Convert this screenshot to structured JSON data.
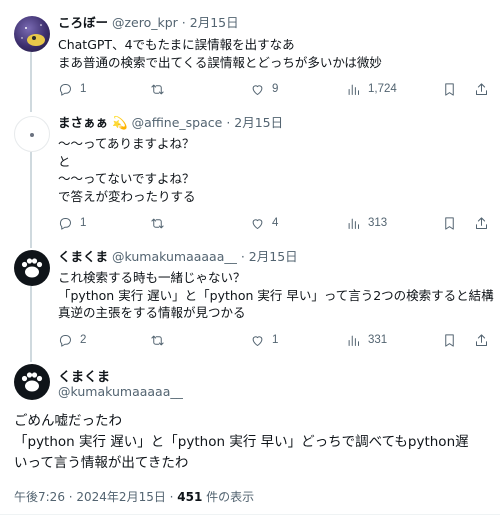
{
  "replies": [
    {
      "name": "ころぼー",
      "handle": "@zero_kpr",
      "date": "2月15日",
      "text": "ChatGPT、4でもたまに誤情報を出すなあ\nまあ普通の検索で出てくる誤情報とどっちが多いかは微妙",
      "reply_count": "1",
      "retweet_count": "",
      "like_count": "9",
      "view_count": "1,724"
    },
    {
      "name": "まさぁぁ",
      "badge": "💫",
      "handle": "@affine_space",
      "date": "2月15日",
      "text": "〜〜ってありますよね？\nと\n〜〜ってないですよね？\nで答えが変わったりする",
      "reply_count": "1",
      "retweet_count": "",
      "like_count": "4",
      "view_count": "313"
    },
    {
      "name": "くまくま",
      "handle": "@kumakumaaaaa__",
      "date": "2月15日",
      "text": "これ検索する時も一緒じゃない？\n「python 実行 遅い」と「python 実行 早い」って言う2つの検索すると結構\n真逆の主張をする情報が見つかる",
      "reply_count": "2",
      "retweet_count": "",
      "like_count": "1",
      "view_count": "331"
    }
  ],
  "main": {
    "name": "くまくま",
    "handle": "@kumakumaaaaa__",
    "text": "ごめん嘘だったわ\n「python 実行 遅い」と「python 実行 早い」どっちで調べてもpython遅\nいって言う情報が出てきたわ",
    "time": "午後7:26 · 2024年2月15日 · ",
    "views_number": "451",
    "views_label": " 件の表示"
  },
  "separator": " · "
}
